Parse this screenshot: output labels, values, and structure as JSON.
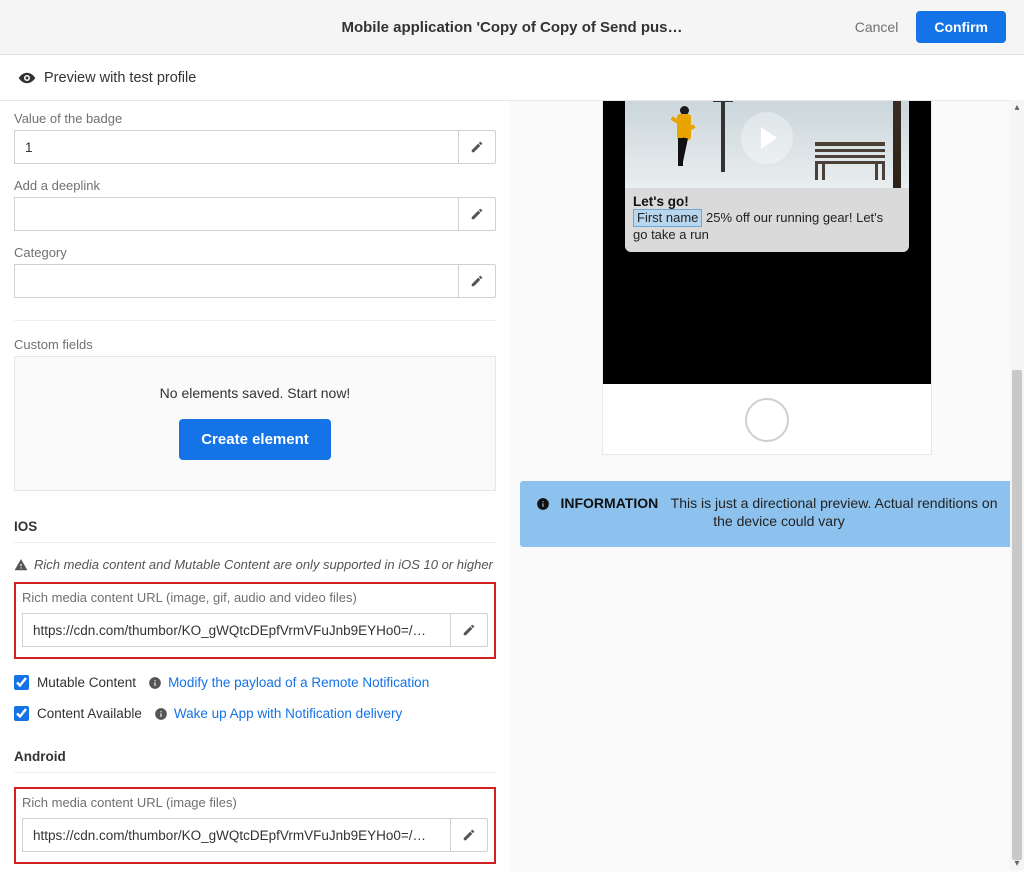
{
  "header": {
    "title": "Mobile application 'Copy of Copy of Send pus…",
    "cancel": "Cancel",
    "confirm": "Confirm"
  },
  "subheader": {
    "preview": "Preview with test profile"
  },
  "form": {
    "badge": {
      "label": "Value of the badge",
      "value": "1"
    },
    "deeplink": {
      "label": "Add a deeplink",
      "value": ""
    },
    "category": {
      "label": "Category",
      "value": ""
    }
  },
  "customFields": {
    "label": "Custom fields",
    "empty": "No elements saved. Start now!",
    "create": "Create element"
  },
  "ios": {
    "heading": "IOS",
    "warning": "Rich media content and Mutable Content are only supported in iOS 10 or higher",
    "richMediaLabel": "Rich media content URL (image, gif, audio and video files)",
    "richMediaValue": "https://cdn.com/thumbor/KO_gWQtcDEpfVrmVFuJnb9EYHo0=/…",
    "mutable": {
      "label": "Mutable Content",
      "link": "Modify the payload of a Remote Notification",
      "checked": true
    },
    "available": {
      "label": "Content Available",
      "link": "Wake up App with Notification delivery",
      "checked": true
    }
  },
  "android": {
    "heading": "Android",
    "richMediaLabel": "Rich media content URL (image files)",
    "richMediaValue": "https://cdn.com/thumbor/KO_gWQtcDEpfVrmVFuJnb9EYHo0=/…"
  },
  "preview": {
    "notifTitle": "Let's go!",
    "chip": "First name",
    "bodyRest": "  25% off our running gear! Let's go take a run"
  },
  "infoBanner": {
    "label": "INFORMATION",
    "text": "This is just a directional preview. Actual renditions on the device could vary"
  }
}
